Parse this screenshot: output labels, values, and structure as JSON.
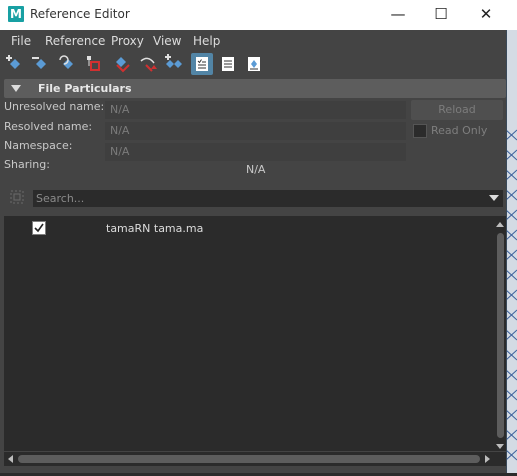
{
  "window": {
    "title": "Reference Editor",
    "app_icon_letter": "M",
    "minimize": "—",
    "maximize": "☐",
    "close": "✕"
  },
  "menubar": {
    "items": [
      "File",
      "Reference",
      "Proxy",
      "View",
      "Help"
    ]
  },
  "toolbar": {
    "buttons": [
      {
        "name": "create-reference-icon"
      },
      {
        "name": "remove-reference-icon"
      },
      {
        "name": "reload-reference-icon"
      },
      {
        "name": "unload-reference-icon"
      },
      {
        "name": "load-reference-icon"
      },
      {
        "name": "replace-reference-icon"
      },
      {
        "name": "duplicate-reference-icon"
      },
      {
        "name": "list-view-icon",
        "active": true
      },
      {
        "name": "detail-view-icon"
      },
      {
        "name": "expand-view-icon"
      }
    ]
  },
  "file_particulars": {
    "title": "File Particulars",
    "unresolved_label": "Unresolved name:",
    "unresolved_value": "N/A",
    "resolved_label": "Resolved name:",
    "resolved_value": "N/A",
    "namespace_label": "Namespace:",
    "namespace_value": "N/A",
    "sharing_label": "Sharing:",
    "sharing_value": "N/A",
    "reload_label": "Reload",
    "read_only_label": "Read Only"
  },
  "search": {
    "placeholder": "Search..."
  },
  "references": [
    {
      "checked": true,
      "label": "tamaRN tama.ma"
    }
  ],
  "colors": {
    "accent": "#5285a6",
    "window_bg": "#444444",
    "list_bg": "#2b2b2b",
    "brand": "#18a0a3"
  }
}
